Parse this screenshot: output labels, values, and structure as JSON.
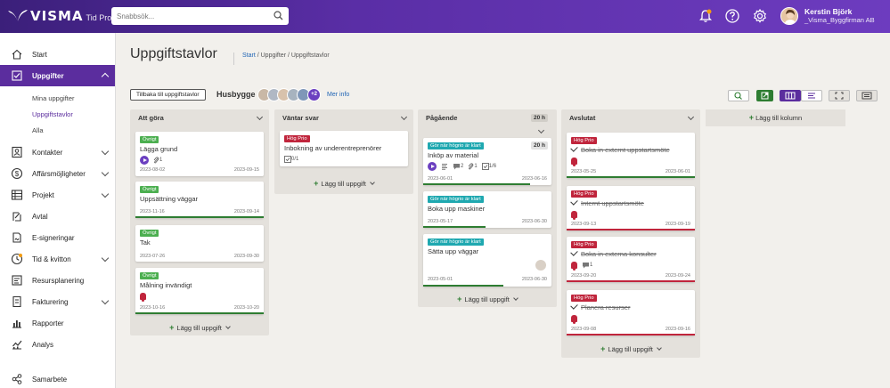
{
  "app": {
    "brand": "VISMA",
    "product": "Tid Pro",
    "search_placeholder": "Snabbsök..."
  },
  "user": {
    "name": "Kerstin Björk",
    "org": "_Visma_Byggfirman AB"
  },
  "sidebar": {
    "items": [
      {
        "label": "Start",
        "icon": "home-icon"
      },
      {
        "label": "Uppgifter",
        "icon": "checkbox-icon",
        "active": true
      },
      {
        "label": "Kontakter",
        "icon": "contacts-icon"
      },
      {
        "label": "Affärsmöjligheter",
        "icon": "dollar-icon"
      },
      {
        "label": "Projekt",
        "icon": "project-icon"
      },
      {
        "label": "Avtal",
        "icon": "contract-icon"
      },
      {
        "label": "E-signeringar",
        "icon": "signature-icon"
      },
      {
        "label": "Tid & kvitton",
        "icon": "clock-icon"
      },
      {
        "label": "Resursplanering",
        "icon": "resource-icon"
      },
      {
        "label": "Fakturering",
        "icon": "invoice-icon"
      },
      {
        "label": "Rapporter",
        "icon": "bar-chart-icon"
      },
      {
        "label": "Analys",
        "icon": "analytics-icon"
      },
      {
        "label": "Samarbete",
        "icon": "share-icon"
      }
    ],
    "sub_items": [
      "Mina uppgifter",
      "Uppgiftstavlor",
      "Alla"
    ]
  },
  "page": {
    "title": "Uppgiftstavlor",
    "breadcrumb_home": "Start",
    "breadcrumb_rest": " / Uppgifter / Uppgiftstavlor",
    "back_label": "Tillbaka till uppgiftstavlor",
    "board_name": "Husbygge",
    "members_more": "+2",
    "more_info": "Mer info",
    "add_task": "Lägg till uppgift",
    "add_column": "Lägg till kolumn"
  },
  "columns": [
    {
      "title": "Att göra",
      "cards": [
        {
          "tag": "Övrigt",
          "title": "Lägga grund",
          "start": "2023-08-02",
          "end": "2023-09-15",
          "attachments": "1"
        },
        {
          "tag": "Övrigt",
          "title": "Uppsättning väggar",
          "start": "2023-11-16",
          "end": "2023-09-14"
        },
        {
          "tag": "Övrigt",
          "title": "Tak",
          "start": "2023-07-26",
          "end": "2023-09-30"
        },
        {
          "tag": "Övrigt",
          "title": "Målning invändigt",
          "start": "2023-10-16",
          "end": "2023-10-20"
        }
      ]
    },
    {
      "title": "Väntar svar",
      "cards": [
        {
          "tag": "Hög Prio",
          "title": "Inbokning av underentreprenörer",
          "checklist": "0/1"
        }
      ]
    },
    {
      "title": "Pågående",
      "hours": "20 h",
      "cards": [
        {
          "tag": "Gör när högrio är klart",
          "title": "Inköp av material",
          "hours": "20 h",
          "start": "2023-06-01",
          "end": "2023-06-16",
          "comments": "2",
          "attachments": "1",
          "checklist": "1/6"
        },
        {
          "tag": "Gör när högrio är klart",
          "title": "Boka upp maskiner",
          "start": "2023-05-17",
          "end": "2023-06-30"
        },
        {
          "tag": "Gör när högrio är klart",
          "title": "Sätta upp väggar",
          "start": "2023-05-01",
          "end": "2023-06-30"
        }
      ]
    },
    {
      "title": "Avslutat",
      "cards": [
        {
          "tag": "Hög Prio",
          "title": "Boka in externt uppstartsmöte",
          "start": "2023-05-25",
          "end": "2023-06-01"
        },
        {
          "tag": "Hög Prio",
          "title": "Internt uppstartsmöte",
          "start": "2023-09-13",
          "end": "2023-09-19"
        },
        {
          "tag": "Hög Prio",
          "title": "Boka in externa konsulter",
          "start": "2023-09-20",
          "end": "2023-09-24",
          "comments": "1"
        },
        {
          "tag": "Hög Prio",
          "title": "Planera resurser",
          "start": "2023-09-08",
          "end": "2023-09-16"
        }
      ]
    }
  ],
  "colors": {
    "topbar": "#5a2ea6",
    "active_nav": "#5b2d9e",
    "tag_green": "#4caf50",
    "tag_red": "#c0253c",
    "tag_teal": "#1fa8b0",
    "progress_green": "#2e7d32"
  }
}
